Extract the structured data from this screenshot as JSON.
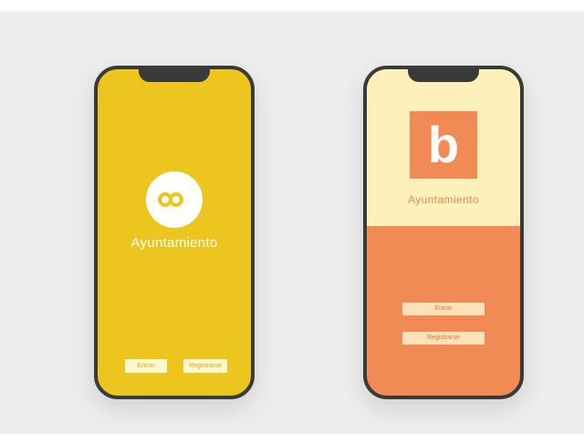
{
  "phone_left": {
    "app_name": "Ayuntamiento",
    "buttons": {
      "enter": "Entrar",
      "register": "Registrarse"
    },
    "logo_icon": "double-circle-logo-icon",
    "colors": {
      "background": "#ecc61f",
      "text": "#ffffff"
    }
  },
  "phone_right": {
    "logo_letter": "b",
    "app_name": "Ayuntamiento",
    "buttons": {
      "enter": "Entrar",
      "register": "Registrarse"
    },
    "colors": {
      "top_background": "#fdf0ba",
      "bottom_background": "#f28a55",
      "accent": "#f28a55"
    }
  }
}
